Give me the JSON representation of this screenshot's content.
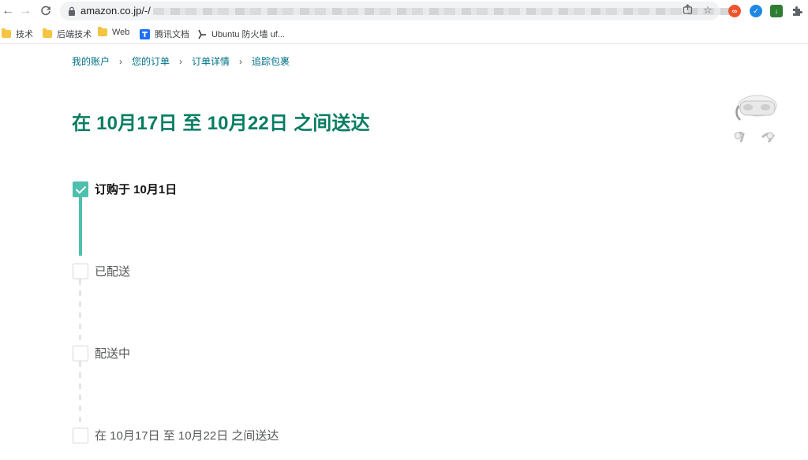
{
  "browser": {
    "url": "amazon.co.jp/-/",
    "bookmarks": [
      {
        "label": "技术",
        "icon": "folder-icon"
      },
      {
        "label": "后端技术",
        "icon": "folder-icon"
      },
      {
        "label": "Web",
        "icon": "folder-icon"
      },
      {
        "label": "腾讯文档",
        "icon": "tencent-docs-icon"
      },
      {
        "label": "Ubuntu 防火墙 uf...",
        "icon": "ubuntu-icon"
      }
    ]
  },
  "breadcrumb": {
    "items": [
      "我的账户",
      "您的订单",
      "订单详情",
      "追踪包裹"
    ],
    "separator": "›"
  },
  "delivery": {
    "title": "在 10月17日 至 10月22日 之间送达"
  },
  "tracking": {
    "steps": [
      {
        "label": "订购于 10月1日",
        "completed": true
      },
      {
        "label": "已配送",
        "completed": false
      },
      {
        "label": "配送中",
        "completed": false
      },
      {
        "label": "在 10月17日 至 10月22日 之间送达",
        "completed": false
      }
    ]
  },
  "colors": {
    "accent": "#4fbfae",
    "title": "#067d62",
    "link": "#007185"
  }
}
